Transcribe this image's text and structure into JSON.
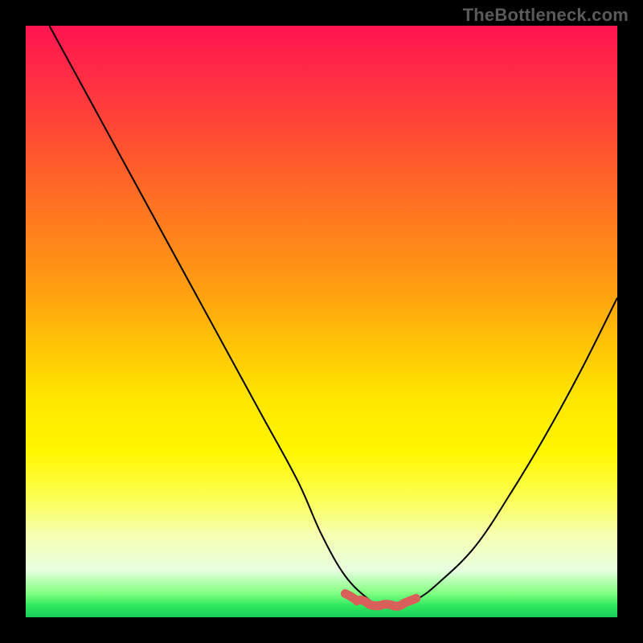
{
  "watermark": "TheBottleneck.com",
  "chart_data": {
    "type": "line",
    "title": "",
    "xlabel": "",
    "ylabel": "",
    "xlim": [
      0,
      100
    ],
    "ylim": [
      0,
      100
    ],
    "grid": false,
    "legend": false,
    "series": [
      {
        "name": "curve",
        "color": "#000000",
        "x": [
          4,
          10,
          16,
          22,
          28,
          34,
          40,
          46,
          50,
          54,
          58,
          60,
          62,
          66,
          70,
          76,
          82,
          88,
          94,
          100
        ],
        "y": [
          100,
          89,
          78,
          67,
          56,
          45,
          34,
          23,
          14,
          7,
          3,
          2,
          2,
          3,
          6,
          12,
          21,
          31,
          42,
          54
        ]
      }
    ],
    "highlight": {
      "name": "optimal-range",
      "color": "#d9605a",
      "x": [
        54,
        56,
        58,
        60,
        62,
        64,
        66
      ],
      "y": [
        4.0,
        2.8,
        2.2,
        2.0,
        2.0,
        2.4,
        3.2
      ]
    },
    "background": {
      "type": "vertical-gradient",
      "stops": [
        {
          "pos": 0.0,
          "color": "#ff1450"
        },
        {
          "pos": 0.2,
          "color": "#ff5030"
        },
        {
          "pos": 0.45,
          "color": "#ffa010"
        },
        {
          "pos": 0.63,
          "color": "#ffe600"
        },
        {
          "pos": 0.86,
          "color": "#f5ffb0"
        },
        {
          "pos": 1.0,
          "color": "#18ce58"
        }
      ]
    }
  }
}
